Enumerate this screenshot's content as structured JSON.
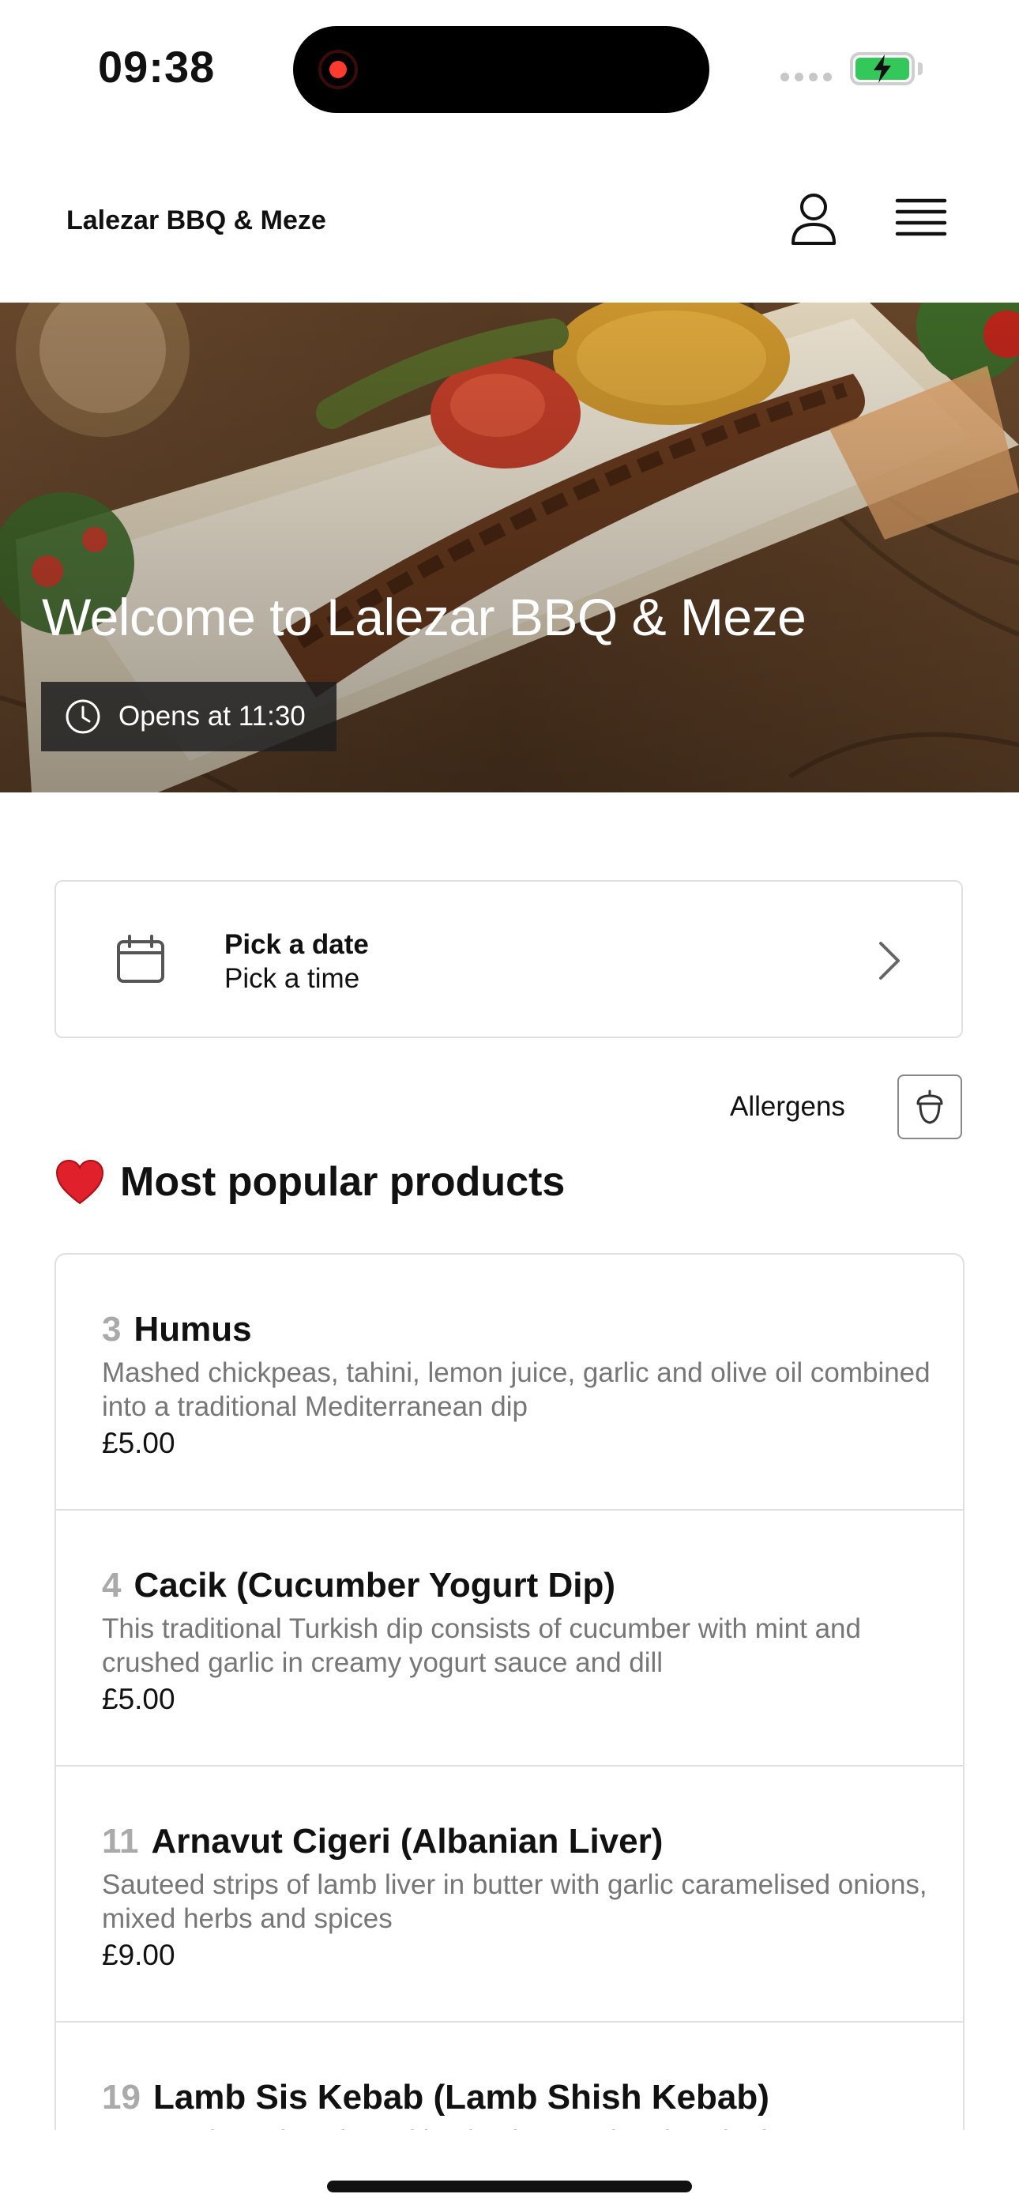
{
  "status_bar": {
    "time": "09:38"
  },
  "header": {
    "brand": "Lalezar BBQ & Meze"
  },
  "hero": {
    "title": "Welcome to Lalezar BBQ & Meze",
    "opens": "Opens at 11:30"
  },
  "order_time": {
    "date_label": "Pick a date",
    "time_label": "Pick a time"
  },
  "allergens": {
    "label": "Allergens"
  },
  "popular": {
    "title": "Most popular products",
    "items": [
      {
        "number": "3",
        "name": "Humus",
        "description": "Mashed chickpeas, tahini, lemon juice, garlic and olive oil combined into a traditional Mediterranean dip",
        "price": "£5.00"
      },
      {
        "number": "4",
        "name": "Cacik (Cucumber Yogurt Dip)",
        "description": "This traditional Turkish dip consists of cucumber with mint and crushed garlic in creamy yogurt sauce and dill",
        "price": "£5.00"
      },
      {
        "number": "11",
        "name": "Arnavut Cigeri (Albanian Liver)",
        "description": "Sauteed strips of lamb liver in butter with garlic caramelised onions, mixed herbs and spices",
        "price": "£9.00"
      },
      {
        "number": "19",
        "name": "Lamb Sis Kebab (Lamb Shish Kebab)",
        "description": "Large cubes of marinated lamb, skewered and cooked on a",
        "price": ""
      }
    ]
  }
}
